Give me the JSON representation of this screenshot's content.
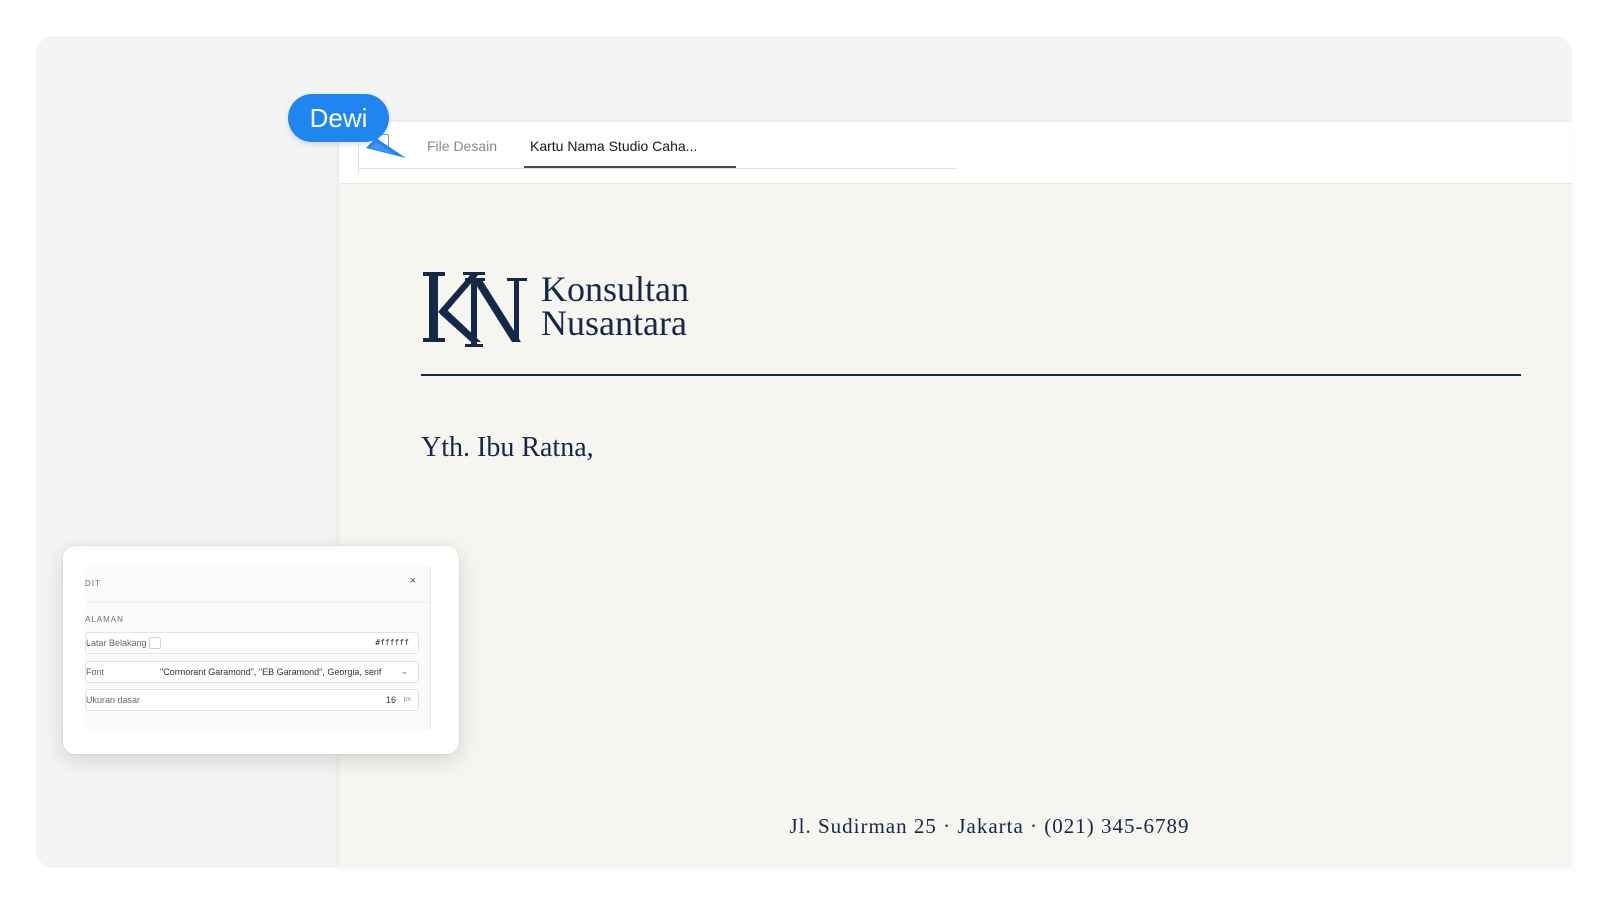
{
  "collaborator": {
    "name": "Dewi",
    "color": "#1f86f0"
  },
  "tabs": {
    "files_label": "File Desain",
    "active_label": "Kartu Nama Studio Caha..."
  },
  "letter": {
    "monogram": "KN",
    "brand_line1": "Konsultan",
    "brand_line2": "Nusantara",
    "salutation": "Yth. Ibu Ratna,",
    "footer": "Jl. Sudirman 25 · Jakarta · (021) 345-6789",
    "ink_color": "#14284a",
    "paper_color": "#f7f5f0"
  },
  "edit_panel": {
    "title": "DIT",
    "close_label": "×",
    "section": "ALAMAN",
    "background_label": "Latar Belakang",
    "background_value": "#ffffff",
    "font_label": "Font",
    "font_value": "\"Cormorant Garamond\", \"EB Garamond\", Georgia, serif",
    "base_size_label": "Ukuran dasar",
    "base_size_value": "16",
    "base_size_unit": "px"
  }
}
